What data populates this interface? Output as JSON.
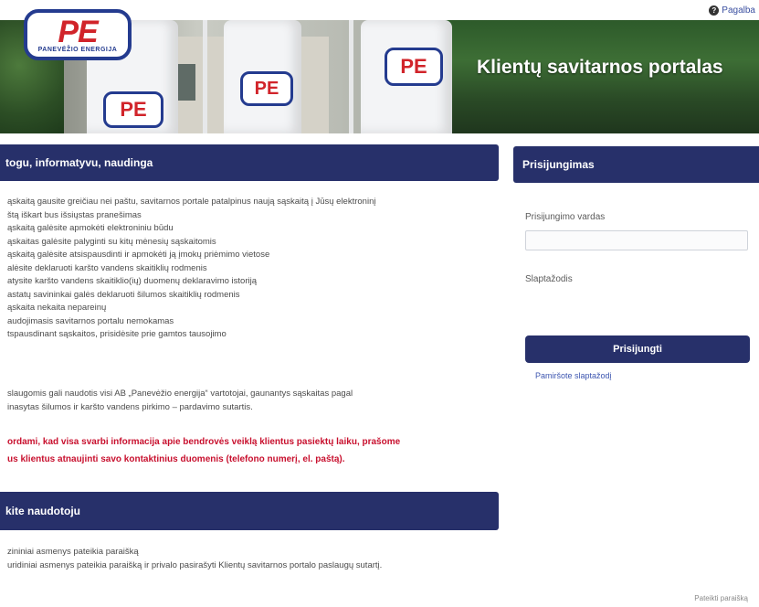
{
  "header": {
    "logo_text": "PE",
    "logo_subtext": "PANEVĖŽIO ENERGIJA",
    "portal_title": "Klientų savitarnos portalas",
    "help_label": "Pagalba"
  },
  "info_panel": {
    "heading": "togu, informatyvu, naudinga",
    "items": [
      "ąskaitą gausite greičiau nei paštu, savitarnos portale patalpinus naują sąskaitą į Jūsų elektroninį",
      "štą iškart bus išsiųstas pranešimas",
      "ąskaitą galėsite apmokėti elektroniniu būdu",
      "ąskaitas galėsite palyginti su kitų mėnesių sąskaitomis",
      "ąskaitą galėsite atsispausdinti ir apmokėti ją įmokų priėmimo vietose",
      "alėsite deklaruoti karšto vandens skaitiklių rodmenis",
      "atysite karšto vandens skaitiklio(ių) duomenų deklaravimo istoriją",
      "astatų savininkai galės deklaruoti šilumos skaitiklių rodmenis",
      "ąskaita nekaita nepareinų",
      "audojimasis savitarnos portalu nemokamas",
      "tspausdinant sąskaitos, prisidėsite prie gamtos tausojimo"
    ],
    "note_lines": [
      "slaugomis gali naudotis visi AB „Panevėžio energija“ vartotojai, gaunantys sąskaitas pagal",
      "inasytas šilumos ir karšto vandens pirkimo – pardavimo sutartis."
    ],
    "warning_lines": [
      "ordami, kad visa svarbi informacija apie bendrovės veiklą klientus pasiektų laiku, prašome",
      "us klientus atnaujinti savo kontaktinius duomenis (telefono numerį, el. paštą)."
    ]
  },
  "login_panel": {
    "heading": "Prisijungimas",
    "username_label": "Prisijungimo vardas",
    "username_value": "",
    "password_label": "Slaptažodis",
    "password_value": "",
    "submit_label": "Prisijungti",
    "forgot_label": "Pamiršote slaptažodį"
  },
  "register_panel": {
    "heading": "kite naudotoju",
    "lines": [
      "zininiai asmenys pateikia paraišką",
      "uridiniai asmenys pateikia paraišką ir privalo pasirašyti Klientų savitarnos portalo paslaugų sutartį."
    ]
  },
  "footer": {
    "link_label": "Pateikti paraišką"
  },
  "colors": {
    "panel_header": "#27306a",
    "warning": "#c8102e",
    "brand_red": "#d1242a",
    "brand_blue": "#243b8f"
  }
}
